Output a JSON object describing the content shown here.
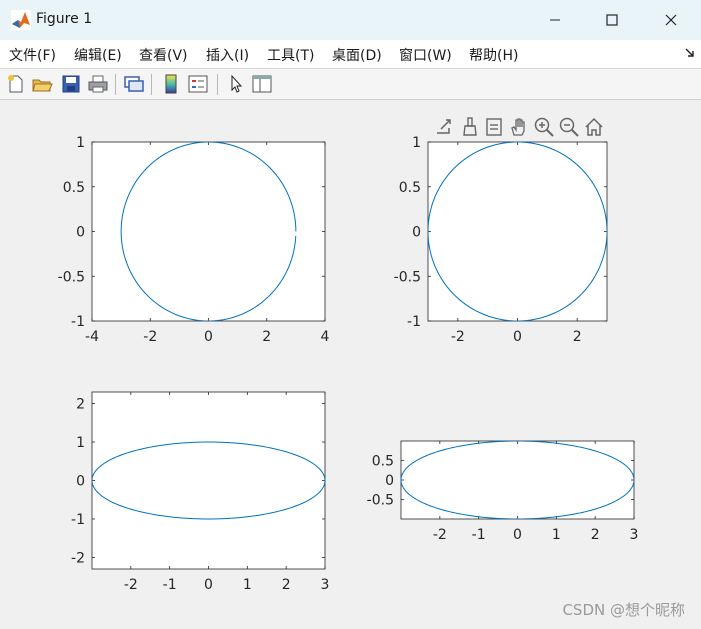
{
  "window": {
    "title": "Figure 1",
    "minimize_glyph": "—",
    "close_glyph": "✕"
  },
  "menu": {
    "items": [
      "文件(F)",
      "编辑(E)",
      "查看(V)",
      "插入(I)",
      "工具(T)",
      "桌面(D)",
      "窗口(W)",
      "帮助(H)"
    ]
  },
  "toolbar": {
    "icons": [
      "new-figure-icon",
      "open-file-icon",
      "save-icon",
      "print-icon",
      "link-plot-icon",
      "insert-colorbar-icon",
      "insert-legend-icon",
      "edit-plot-icon",
      "property-inspector-icon"
    ]
  },
  "axes_toolbar": {
    "icons": [
      "export-icon",
      "brush-icon",
      "data-tips-icon",
      "pan-icon",
      "zoom-in-icon",
      "zoom-out-icon",
      "restore-view-icon"
    ]
  },
  "colors": {
    "line": "#0072bd",
    "titlebar": "#e9f4f9",
    "background": "#f0f0f0"
  },
  "watermark": "CSDN @想个昵称",
  "chart_data": [
    {
      "type": "line",
      "curve": "ellipse x=3cos(t), y=sin(t), gap near (3,0)",
      "xlim": [
        -4,
        4
      ],
      "ylim": [
        -1,
        1
      ],
      "xticks": [
        "-4",
        "-2",
        "0",
        "2",
        "4"
      ],
      "yticks": [
        "1",
        "0.5",
        "0",
        "-0.5",
        "-1"
      ],
      "x": [
        3,
        2.6,
        1.5,
        0,
        -1.5,
        -2.6,
        -3,
        -2.6,
        -1.5,
        0,
        1.5,
        2.6,
        3
      ],
      "y": [
        0,
        0.5,
        0.87,
        1,
        0.87,
        0.5,
        0,
        -0.5,
        -0.87,
        -1,
        -0.87,
        -0.5,
        -0.05
      ]
    },
    {
      "type": "line",
      "curve": "ellipse x=3cos(t), y=sin(t)",
      "xlim": [
        -3,
        3
      ],
      "ylim": [
        -1,
        1
      ],
      "xticks": [
        "-2",
        "0",
        "2"
      ],
      "yticks": [
        "1",
        "0.5",
        "0",
        "-0.5",
        "-1"
      ],
      "x": [
        3,
        2.6,
        1.5,
        0,
        -1.5,
        -2.6,
        -3,
        -2.6,
        -1.5,
        0,
        1.5,
        2.6,
        3
      ],
      "y": [
        0,
        0.5,
        0.87,
        1,
        0.87,
        0.5,
        0,
        -0.5,
        -0.87,
        -1,
        -0.87,
        -0.5,
        0
      ]
    },
    {
      "type": "line",
      "curve": "ellipse x=3cos(t), y=sin(t)",
      "xlim": [
        -3,
        3
      ],
      "ylim": [
        -2.3,
        2.3
      ],
      "xticks": [
        "-2",
        "-1",
        "0",
        "1",
        "2",
        "3"
      ],
      "yticks": [
        "2",
        "1",
        "0",
        "-1",
        "-2"
      ],
      "x": [
        3,
        2.6,
        1.5,
        0,
        -1.5,
        -2.6,
        -3,
        -2.6,
        -1.5,
        0,
        1.5,
        2.6,
        3
      ],
      "y": [
        0,
        0.5,
        0.87,
        1,
        0.87,
        0.5,
        0,
        -0.5,
        -0.87,
        -1,
        -0.87,
        -0.5,
        0
      ]
    },
    {
      "type": "line",
      "curve": "ellipse x=3cos(t), y=sin(t)",
      "xlim": [
        -3,
        3
      ],
      "ylim": [
        -1,
        1
      ],
      "xticks": [
        "-2",
        "-1",
        "0",
        "1",
        "2",
        "3"
      ],
      "yticks": [
        "0.5",
        "0",
        "-0.5"
      ],
      "x": [
        3,
        2.6,
        1.5,
        0,
        -1.5,
        -2.6,
        -3,
        -2.6,
        -1.5,
        0,
        1.5,
        2.6,
        3
      ],
      "y": [
        0,
        0.5,
        0.87,
        1,
        0.87,
        0.5,
        0,
        -0.5,
        -0.87,
        -1,
        -0.87,
        -0.5,
        0
      ]
    }
  ]
}
